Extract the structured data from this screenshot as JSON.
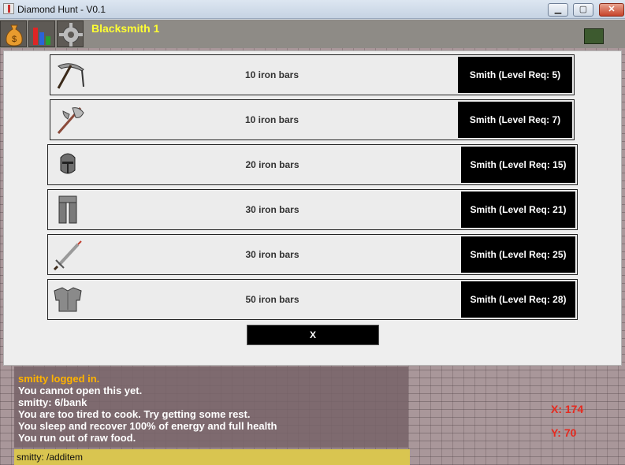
{
  "window": {
    "title": "Diamond Hunt - V0.1",
    "buttons": {
      "minimize": "▁",
      "maximize": "▢",
      "close": "✕"
    }
  },
  "topbar": {
    "title": "Blacksmith 1",
    "icons": [
      "money-bag-icon",
      "stats-chart-icon",
      "settings-gear-icon",
      "map-icon"
    ]
  },
  "smithing": {
    "items": [
      {
        "icon": "pickaxe-icon",
        "cost": "10 iron bars",
        "action": "Smith (Level Req: 5)"
      },
      {
        "icon": "axe-icon",
        "cost": "10 iron bars",
        "action": "Smith (Level Req: 7)"
      },
      {
        "icon": "helmet-icon",
        "cost": "20 iron bars",
        "action": "Smith (Level Req: 15)"
      },
      {
        "icon": "platelegs-icon",
        "cost": "30 iron bars",
        "action": "Smith (Level Req: 21)"
      },
      {
        "icon": "sword-icon",
        "cost": "30 iron bars",
        "action": "Smith (Level Req: 25)"
      },
      {
        "icon": "platebody-icon",
        "cost": "50 iron bars",
        "action": "Smith (Level Req: 28)"
      }
    ],
    "close_label": "X"
  },
  "chat": {
    "lines": [
      {
        "text": "smitty logged in.",
        "type": "system"
      },
      {
        "text": "You cannot open this yet.",
        "type": "message"
      },
      {
        "text": "smitty: 6/bank",
        "type": "message"
      },
      {
        "text": "You are too tired to cook. Try getting some rest.",
        "type": "message"
      },
      {
        "text": "You sleep and recover 100% of energy and full health",
        "type": "message"
      },
      {
        "text": "You run out of raw food.",
        "type": "message"
      }
    ],
    "input_value": "smitty: /additem"
  },
  "hud": {
    "x_label": "X: 174",
    "y_label": "Y: 70"
  },
  "colors": {
    "title_yellow": "#ffff33",
    "coord_red": "#e62a1f",
    "system_orange": "#ffb300",
    "button_black": "#000000"
  }
}
